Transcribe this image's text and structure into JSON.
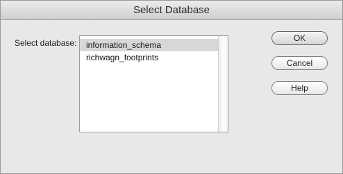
{
  "window": {
    "title": "Select Database"
  },
  "form": {
    "label": "Select database:"
  },
  "listbox": {
    "items": [
      {
        "label": "information_schema",
        "selected": true
      },
      {
        "label": "richwagn_footprints",
        "selected": false
      }
    ]
  },
  "buttons": {
    "ok": "OK",
    "cancel": "Cancel",
    "help": "Help"
  }
}
